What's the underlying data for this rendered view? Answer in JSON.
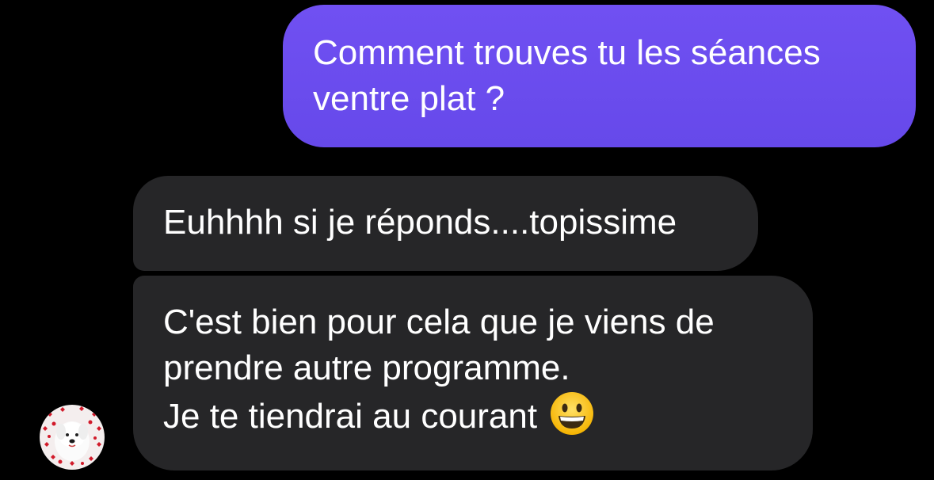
{
  "conversation": {
    "sent_message": {
      "lines": [
        "Comment trouves tu les séances",
        "ventre plat ?"
      ]
    },
    "received_messages": [
      {
        "lines": [
          "Euhhhh si je réponds....topissime"
        ]
      },
      {
        "lines": [
          "C'est bien pour cela que je viens de",
          "prendre autre programme.",
          "Je te tiendrai au courant"
        ],
        "emoji": "grinning-face-icon"
      }
    ],
    "sender_avatar": "dog-avatar-with-hearts"
  },
  "colors": {
    "background": "#000000",
    "sent_bubble": "#6a4ff0",
    "received_bubble": "#262628",
    "text": "#ffffff"
  }
}
